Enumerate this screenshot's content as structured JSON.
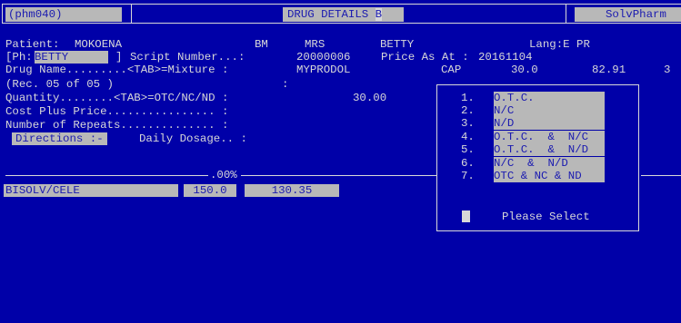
{
  "header": {
    "screen_code": "(phm040)",
    "title": "DRUG DETAILS",
    "title_suffix": "B",
    "brand": "SolvPharm"
  },
  "patient": {
    "label": "Patient:",
    "surname": "MOKOENA",
    "initials": "BM",
    "title": "MRS",
    "first_name": "BETTY",
    "lang": "Lang:E PR"
  },
  "ph": {
    "prefix": "[Ph:",
    "value": "BETTY",
    "suffix": "]",
    "script_label": "Script Number...:",
    "script_number": "20000006",
    "price_as_at_label": "Price As At :",
    "price_as_at": "20161104"
  },
  "drug": {
    "label": "Drug Name.........<TAB>=Mixture :",
    "name": "MYPRODOL",
    "form": "CAP",
    "qty": "30.0",
    "price": "82.91",
    "extra": "3"
  },
  "rec": "(Rec. 05 of 05 )",
  "rec_colon": ":",
  "quantity": {
    "label": "Quantity........<TAB>=OTC/NC/ND :",
    "value": "30.00"
  },
  "cost_plus": "Cost Plus Price................ :",
  "repeats": "Number of Repeats.............. :",
  "directions": {
    "label": "Directions :-",
    "daily": "Daily Dosage.. :"
  },
  "divider_pct": ".00%",
  "bottom_fields": [
    "BISOLV/CELE",
    "150.0",
    "130.35"
  ],
  "menu": {
    "options": [
      {
        "num": "1.",
        "label": "O.T.C."
      },
      {
        "num": "2.",
        "label": "N/C"
      },
      {
        "num": "3.",
        "label": "N/D"
      },
      {
        "num": "4.",
        "label": "O.T.C.  &  N/C"
      },
      {
        "num": "5.",
        "label": "O.T.C.  &  N/D"
      },
      {
        "num": "6.",
        "label": "N/C  &  N/D"
      },
      {
        "num": "7.",
        "label": "OTC & NC & ND"
      }
    ],
    "prompt": "Please Select"
  }
}
